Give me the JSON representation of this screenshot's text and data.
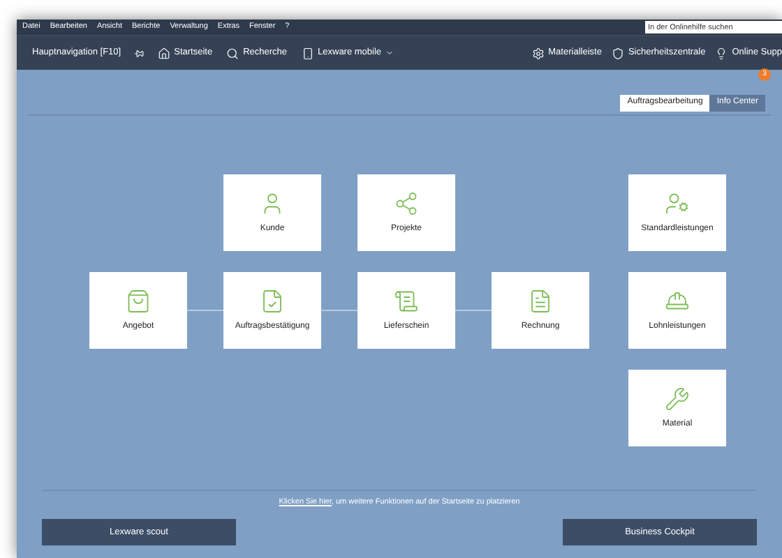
{
  "menu": [
    "Datei",
    "Bearbeiten",
    "Ansicht",
    "Berichte",
    "Verwaltung",
    "Extras",
    "Fenster",
    "?"
  ],
  "help_search": {
    "placeholder": "In der Onlinehilfe suchen"
  },
  "navbar": {
    "title": "Hauptnavigation [F10]",
    "left_items": [
      {
        "kind": "home",
        "label": "Startseite"
      },
      {
        "kind": "search",
        "label": "Recherche"
      },
      {
        "kind": "mobile",
        "label": "Lexware mobile",
        "dropdown": true
      }
    ],
    "right_items": [
      {
        "kind": "gear",
        "label": "Materialleiste"
      },
      {
        "kind": "shield",
        "label": "Sicherheitszentrale"
      },
      {
        "kind": "bulb",
        "label": "Online Supp"
      }
    ]
  },
  "tabs": [
    {
      "label": "Auftragsbearbeitung",
      "selected": true
    },
    {
      "label": "Info Center",
      "selected": false,
      "badge": "3"
    }
  ],
  "top_tiles": [
    {
      "kind": "user",
      "label": "Kunde"
    },
    {
      "kind": "network",
      "label": "Projekte"
    }
  ],
  "document_flow": [
    {
      "kind": "bag",
      "label": "Angebot"
    },
    {
      "kind": "filecheck",
      "label": "Auftragsbestätigung"
    },
    {
      "kind": "delivery",
      "label": "Lieferschein"
    },
    {
      "kind": "invoice",
      "label": "Rechnung"
    }
  ],
  "services": [
    {
      "kind": "standard",
      "label": "Standardleistungen"
    },
    {
      "kind": "labor",
      "label": "Lohnleistungen"
    },
    {
      "kind": "material",
      "label": "Material"
    }
  ],
  "hint": {
    "link": "Klicken Sie hier",
    "text": ", um weitere Funktionen auf der Startseite zu platzieren"
  },
  "buttons": [
    "Lexware scout",
    "Business Cockpit"
  ]
}
